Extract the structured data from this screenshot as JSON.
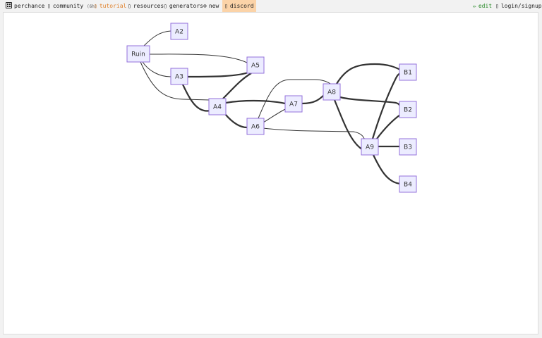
{
  "topbar": {
    "brand": "perchance",
    "community": "community",
    "community_count": "(6h)",
    "tutorial": "tutorial",
    "resources": "resources",
    "generators": "generators",
    "new": "new",
    "discord": "discord",
    "edit": "edit",
    "login": "login/signup"
  },
  "graph": {
    "nodes": [
      {
        "id": "Ruin",
        "label": "Ruin"
      },
      {
        "id": "A2",
        "label": "A2"
      },
      {
        "id": "A3",
        "label": "A3"
      },
      {
        "id": "A4",
        "label": "A4"
      },
      {
        "id": "A5",
        "label": "A5"
      },
      {
        "id": "A6",
        "label": "A6"
      },
      {
        "id": "A7",
        "label": "A7"
      },
      {
        "id": "A8",
        "label": "A8"
      },
      {
        "id": "A9",
        "label": "A9"
      },
      {
        "id": "B1",
        "label": "B1"
      },
      {
        "id": "B2",
        "label": "B2"
      },
      {
        "id": "B3",
        "label": "B3"
      },
      {
        "id": "B4",
        "label": "B4"
      }
    ],
    "edges": [
      {
        "from": "Ruin",
        "to": "A2",
        "thick": false
      },
      {
        "from": "Ruin",
        "to": "A3",
        "thick": false
      },
      {
        "from": "Ruin",
        "to": "A5",
        "thick": false
      },
      {
        "from": "Ruin",
        "to": "A4",
        "thick": false
      },
      {
        "from": "A3",
        "to": "A5",
        "thick": true
      },
      {
        "from": "A3",
        "to": "A4",
        "thick": true
      },
      {
        "from": "A4",
        "to": "A5",
        "thick": true
      },
      {
        "from": "A4",
        "to": "A7",
        "thick": true
      },
      {
        "from": "A4",
        "to": "A6",
        "thick": true
      },
      {
        "from": "A6",
        "to": "A8",
        "thick": false
      },
      {
        "from": "A6",
        "to": "A7",
        "thick": false
      },
      {
        "from": "A6",
        "to": "A9",
        "thick": false
      },
      {
        "from": "A7",
        "to": "A8",
        "thick": true
      },
      {
        "from": "A8",
        "to": "B1",
        "thick": true
      },
      {
        "from": "A8",
        "to": "B2",
        "thick": true
      },
      {
        "from": "A8",
        "to": "A9",
        "thick": true
      },
      {
        "from": "A9",
        "to": "B1",
        "thick": true
      },
      {
        "from": "A9",
        "to": "B2",
        "thick": true
      },
      {
        "from": "A9",
        "to": "B3",
        "thick": true
      },
      {
        "from": "A9",
        "to": "B4",
        "thick": true
      }
    ]
  }
}
